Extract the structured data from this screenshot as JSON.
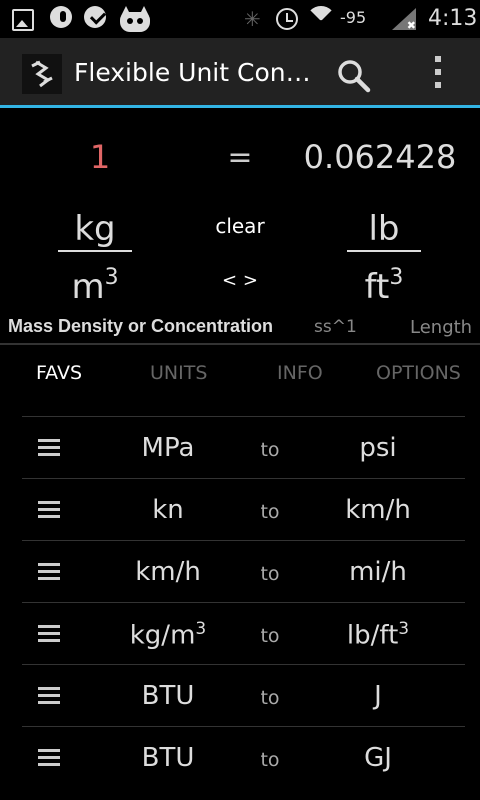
{
  "status_bar": {
    "icons": [
      "picture-icon",
      "mic-icon",
      "check-icon",
      "cat-icon",
      "bluetooth-icon",
      "alarm-icon",
      "wifi-icon",
      "signal-icon"
    ],
    "signal_text": "-95",
    "time": "4:13"
  },
  "action_bar": {
    "title": "Flexible Unit Con…",
    "accent": "#33b5e5"
  },
  "conversion": {
    "input_value": "1",
    "equals": "=",
    "output_value": "0.062428",
    "from_numerator": "kg",
    "from_denominator": "m",
    "from_exponent": "3",
    "to_numerator": "lb",
    "to_denominator": "ft",
    "to_exponent": "3",
    "clear_label": "clear",
    "swap_label": "< >",
    "input_color": "#e06666"
  },
  "categories": {
    "active": "Mass Density or Concentration",
    "next": "ss^1",
    "next2": "Length"
  },
  "tabs": [
    {
      "label": "FAVS",
      "active": true
    },
    {
      "label": "UNITS",
      "active": false
    },
    {
      "label": "INFO",
      "active": false
    },
    {
      "label": "OPTIONS",
      "active": false
    }
  ],
  "favorites": [
    {
      "from": "MPa",
      "to_label": "to",
      "to": "psi"
    },
    {
      "from": "kn",
      "to_label": "to",
      "to": "km/h"
    },
    {
      "from": "km/h",
      "to_label": "to",
      "to": "mi/h"
    },
    {
      "from": "kg/m",
      "from_exp": "3",
      "to_label": "to",
      "to": "lb/ft",
      "to_exp": "3"
    },
    {
      "from": "BTU",
      "to_label": "to",
      "to": "J"
    },
    {
      "from": "BTU",
      "to_label": "to",
      "to": "GJ"
    }
  ]
}
